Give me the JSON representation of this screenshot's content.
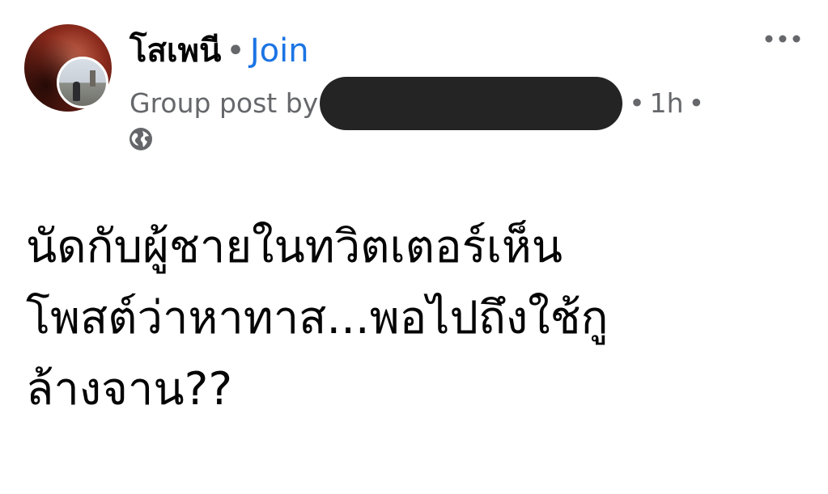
{
  "post": {
    "group_name": "โสเพนี",
    "separator": "•",
    "join_label": "Join",
    "meta_prefix": "Group post by",
    "time_ago": "1h",
    "text": "นัดกับผู้ชายในทวิตเตอร์เห็น\nโพสต์ว่าหาทาส...พอไปถึงใช้กู\nล้างจาน??"
  },
  "icons": {
    "more": "more-horizontal-icon",
    "privacy": "globe-icon"
  },
  "colors": {
    "link": "#1b74e4",
    "secondary_text": "#65676b",
    "primary_text": "#050505",
    "redaction": "#242424"
  }
}
